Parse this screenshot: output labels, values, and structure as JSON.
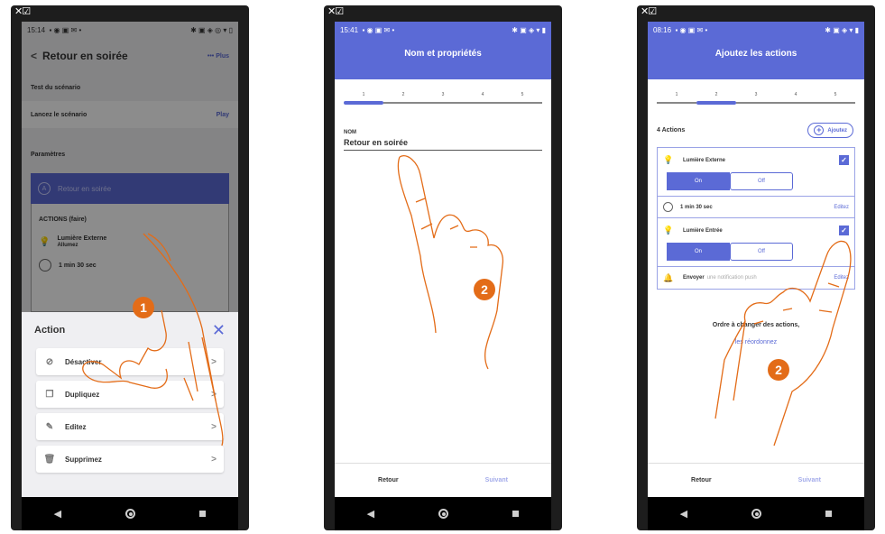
{
  "screen1": {
    "time": "15:14",
    "status_icons": "▪ ◉ ▣ ✉ •",
    "status_right": "✱ ▣ ◈ ◎ ▾ ▯",
    "title": "Retour en soirée",
    "plus_label": "••• Plus",
    "test_label": "Test du scénario",
    "launch_label": "Lancez le scénario",
    "play_label": "Play",
    "params_label": "Paramètres",
    "scenario_name": "Retour en soirée",
    "actions_header": "ACTIONS (faire)",
    "device_name": "Lumière Externe",
    "device_action": "Allumez",
    "timer_label": "1 min 30 sec",
    "sheet_title": "Action",
    "sheet_items": [
      {
        "label": "Désactiver",
        "icon": "⊘"
      },
      {
        "label": "Dupliquez",
        "icon": "❐"
      },
      {
        "label": "Editez",
        "icon": "✎"
      },
      {
        "label": "Supprimez",
        "icon": "🗑"
      }
    ],
    "step_badge": "1"
  },
  "screen2": {
    "time": "15:41",
    "status_icons": "▪ ◉ ▣ ✉ •",
    "status_right": "✱ ▣ ◈ ▾ ▮",
    "title": "Nom et propriétés",
    "steps": [
      "1",
      "2",
      "3",
      "4",
      "5"
    ],
    "active_step": 0,
    "field_label": "NOM",
    "field_value": "Retour en soirée",
    "back_label": "Retour",
    "next_label": "Suivant",
    "step_badge": "2"
  },
  "screen3": {
    "time": "08:16",
    "status_icons": "▪ ◉ ▣ ✉ •",
    "status_right": "✱ ▣ ◈ ▾ ▮",
    "title": "Ajoutez les actions",
    "steps": [
      "1",
      "2",
      "3",
      "4",
      "5"
    ],
    "active_step": 1,
    "actions_count": "4 Actions",
    "add_label": "Ajoutez",
    "device1": "Lumière Externe",
    "device2": "Lumière Entrée",
    "on_label": "On",
    "off_label": "Off",
    "timer_label": "1 min 30 sec",
    "edit_label": "Editez",
    "notif_label": "Envoyer",
    "notif_dim": "une notification push",
    "order_text": "Ordre à changer des actions,",
    "reorder_link": "les réordonnez",
    "back_label": "Retour",
    "next_label": "Suivant",
    "step_badge": "2"
  },
  "window_icon": "✕☑",
  "colors": {
    "accent": "#5b6ad6",
    "badge": "#e36c18",
    "phone": "#1d1d1d"
  }
}
